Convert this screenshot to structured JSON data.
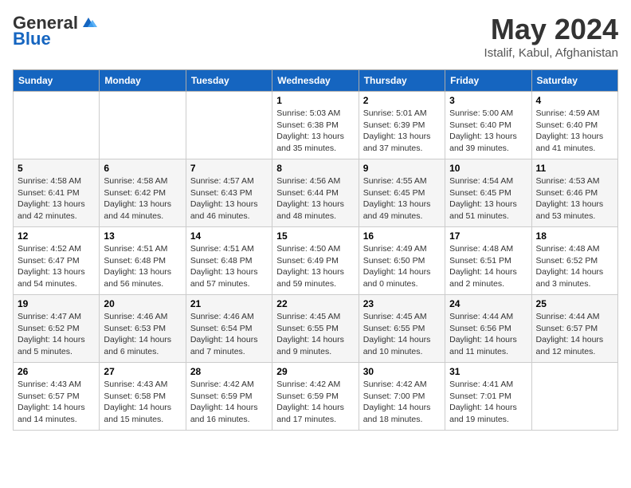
{
  "header": {
    "logo_general": "General",
    "logo_blue": "Blue",
    "month_year": "May 2024",
    "location": "Istalif, Kabul, Afghanistan"
  },
  "days_of_week": [
    "Sunday",
    "Monday",
    "Tuesday",
    "Wednesday",
    "Thursday",
    "Friday",
    "Saturday"
  ],
  "weeks": [
    [
      {
        "day": "",
        "info": ""
      },
      {
        "day": "",
        "info": ""
      },
      {
        "day": "",
        "info": ""
      },
      {
        "day": "1",
        "info": "Sunrise: 5:03 AM\nSunset: 6:38 PM\nDaylight: 13 hours\nand 35 minutes."
      },
      {
        "day": "2",
        "info": "Sunrise: 5:01 AM\nSunset: 6:39 PM\nDaylight: 13 hours\nand 37 minutes."
      },
      {
        "day": "3",
        "info": "Sunrise: 5:00 AM\nSunset: 6:40 PM\nDaylight: 13 hours\nand 39 minutes."
      },
      {
        "day": "4",
        "info": "Sunrise: 4:59 AM\nSunset: 6:40 PM\nDaylight: 13 hours\nand 41 minutes."
      }
    ],
    [
      {
        "day": "5",
        "info": "Sunrise: 4:58 AM\nSunset: 6:41 PM\nDaylight: 13 hours\nand 42 minutes."
      },
      {
        "day": "6",
        "info": "Sunrise: 4:58 AM\nSunset: 6:42 PM\nDaylight: 13 hours\nand 44 minutes."
      },
      {
        "day": "7",
        "info": "Sunrise: 4:57 AM\nSunset: 6:43 PM\nDaylight: 13 hours\nand 46 minutes."
      },
      {
        "day": "8",
        "info": "Sunrise: 4:56 AM\nSunset: 6:44 PM\nDaylight: 13 hours\nand 48 minutes."
      },
      {
        "day": "9",
        "info": "Sunrise: 4:55 AM\nSunset: 6:45 PM\nDaylight: 13 hours\nand 49 minutes."
      },
      {
        "day": "10",
        "info": "Sunrise: 4:54 AM\nSunset: 6:45 PM\nDaylight: 13 hours\nand 51 minutes."
      },
      {
        "day": "11",
        "info": "Sunrise: 4:53 AM\nSunset: 6:46 PM\nDaylight: 13 hours\nand 53 minutes."
      }
    ],
    [
      {
        "day": "12",
        "info": "Sunrise: 4:52 AM\nSunset: 6:47 PM\nDaylight: 13 hours\nand 54 minutes."
      },
      {
        "day": "13",
        "info": "Sunrise: 4:51 AM\nSunset: 6:48 PM\nDaylight: 13 hours\nand 56 minutes."
      },
      {
        "day": "14",
        "info": "Sunrise: 4:51 AM\nSunset: 6:48 PM\nDaylight: 13 hours\nand 57 minutes."
      },
      {
        "day": "15",
        "info": "Sunrise: 4:50 AM\nSunset: 6:49 PM\nDaylight: 13 hours\nand 59 minutes."
      },
      {
        "day": "16",
        "info": "Sunrise: 4:49 AM\nSunset: 6:50 PM\nDaylight: 14 hours\nand 0 minutes."
      },
      {
        "day": "17",
        "info": "Sunrise: 4:48 AM\nSunset: 6:51 PM\nDaylight: 14 hours\nand 2 minutes."
      },
      {
        "day": "18",
        "info": "Sunrise: 4:48 AM\nSunset: 6:52 PM\nDaylight: 14 hours\nand 3 minutes."
      }
    ],
    [
      {
        "day": "19",
        "info": "Sunrise: 4:47 AM\nSunset: 6:52 PM\nDaylight: 14 hours\nand 5 minutes."
      },
      {
        "day": "20",
        "info": "Sunrise: 4:46 AM\nSunset: 6:53 PM\nDaylight: 14 hours\nand 6 minutes."
      },
      {
        "day": "21",
        "info": "Sunrise: 4:46 AM\nSunset: 6:54 PM\nDaylight: 14 hours\nand 7 minutes."
      },
      {
        "day": "22",
        "info": "Sunrise: 4:45 AM\nSunset: 6:55 PM\nDaylight: 14 hours\nand 9 minutes."
      },
      {
        "day": "23",
        "info": "Sunrise: 4:45 AM\nSunset: 6:55 PM\nDaylight: 14 hours\nand 10 minutes."
      },
      {
        "day": "24",
        "info": "Sunrise: 4:44 AM\nSunset: 6:56 PM\nDaylight: 14 hours\nand 11 minutes."
      },
      {
        "day": "25",
        "info": "Sunrise: 4:44 AM\nSunset: 6:57 PM\nDaylight: 14 hours\nand 12 minutes."
      }
    ],
    [
      {
        "day": "26",
        "info": "Sunrise: 4:43 AM\nSunset: 6:57 PM\nDaylight: 14 hours\nand 14 minutes."
      },
      {
        "day": "27",
        "info": "Sunrise: 4:43 AM\nSunset: 6:58 PM\nDaylight: 14 hours\nand 15 minutes."
      },
      {
        "day": "28",
        "info": "Sunrise: 4:42 AM\nSunset: 6:59 PM\nDaylight: 14 hours\nand 16 minutes."
      },
      {
        "day": "29",
        "info": "Sunrise: 4:42 AM\nSunset: 6:59 PM\nDaylight: 14 hours\nand 17 minutes."
      },
      {
        "day": "30",
        "info": "Sunrise: 4:42 AM\nSunset: 7:00 PM\nDaylight: 14 hours\nand 18 minutes."
      },
      {
        "day": "31",
        "info": "Sunrise: 4:41 AM\nSunset: 7:01 PM\nDaylight: 14 hours\nand 19 minutes."
      },
      {
        "day": "",
        "info": ""
      }
    ]
  ]
}
